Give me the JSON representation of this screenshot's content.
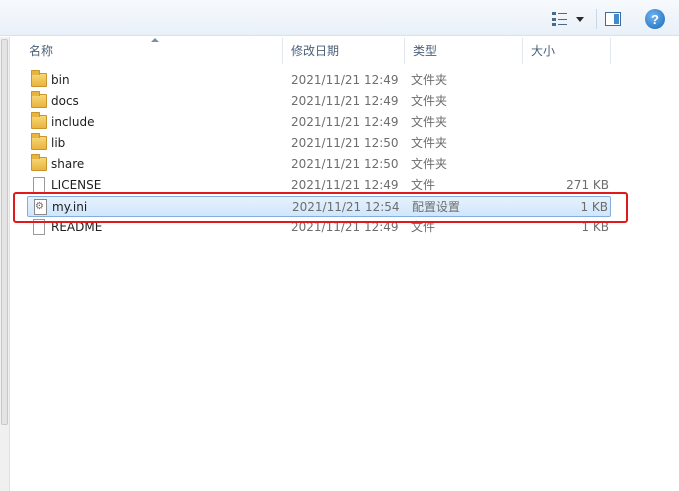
{
  "toolbar": {
    "view_icon": "view-details-icon",
    "dropdown_icon": "chevron-down-icon",
    "pane_icon": "preview-pane-icon",
    "help_icon": "help-icon",
    "help_glyph": "?"
  },
  "columns": {
    "name": "名称",
    "date_modified": "修改日期",
    "type": "类型",
    "size": "大小"
  },
  "files": [
    {
      "name": "bin",
      "date": "2021/11/21 12:49",
      "type": "文件夹",
      "size": "",
      "icon": "folder-icon"
    },
    {
      "name": "docs",
      "date": "2021/11/21 12:49",
      "type": "文件夹",
      "size": "",
      "icon": "folder-icon"
    },
    {
      "name": "include",
      "date": "2021/11/21 12:49",
      "type": "文件夹",
      "size": "",
      "icon": "folder-icon"
    },
    {
      "name": "lib",
      "date": "2021/11/21 12:50",
      "type": "文件夹",
      "size": "",
      "icon": "folder-icon"
    },
    {
      "name": "share",
      "date": "2021/11/21 12:50",
      "type": "文件夹",
      "size": "",
      "icon": "folder-icon"
    },
    {
      "name": "LICENSE",
      "date": "2021/11/21 12:49",
      "type": "文件",
      "size": "271 KB",
      "icon": "file-icon"
    },
    {
      "name": "my.ini",
      "date": "2021/11/21 12:54",
      "type": "配置设置",
      "size": "1 KB",
      "icon": "config-file-icon",
      "selected": true
    },
    {
      "name": "README",
      "date": "2021/11/21 12:49",
      "type": "文件",
      "size": "1 KB",
      "icon": "file-icon"
    }
  ],
  "colors": {
    "highlight_border": "#e0191d",
    "selection_bg": "#cfe6fc",
    "selection_border": "#84acdd",
    "header_text": "#4c607a"
  }
}
